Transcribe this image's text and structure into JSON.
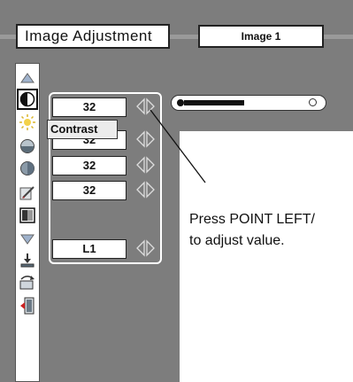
{
  "header": {
    "title": "Image Adjustment",
    "image_label": "Image 1"
  },
  "sidebar": {
    "icons": [
      "up-arrow-icon",
      "contrast-icon",
      "brightness-icon",
      "color-icon",
      "tint-icon",
      "sharpness-icon",
      "gamma-icon",
      "down-arrow-icon",
      "store-icon",
      "reset-icon",
      "quit-icon"
    ]
  },
  "submenu": {
    "values": [
      "32",
      "32",
      "32",
      "32"
    ],
    "gamma_value": "L1"
  },
  "tooltip": "Contrast",
  "slider": {
    "level_fraction": 0.5
  },
  "note": {
    "line1": "Press POINT LEFT/",
    "line2": "to adjust value."
  }
}
